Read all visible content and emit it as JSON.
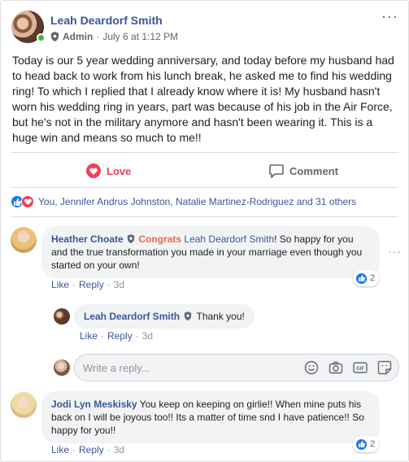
{
  "post": {
    "author": "Leah Deardorf Smith",
    "role": "Admin",
    "date_sep": "·",
    "date": "July 6 at 1:12 PM",
    "more": "···",
    "text": "Today is our 5 year wedding anniversary, and today before my husband had to head back to work from his lunch break, he asked me to find his wedding ring! To which I replied that I already know where it is! My husband hasn't worn his wedding ring in years, part was because of his job in the Air Force, but he's not in the military anymore and hasn't been wearing it. This is a huge win and means so much to me!!"
  },
  "actions": {
    "love": "Love",
    "comment": "Comment"
  },
  "reactions": {
    "summary": "You, Jennifer Andrus Johnston, Natalie Martinez-Rodriguez and 31 others"
  },
  "comments": [
    {
      "author": "Heather Choate",
      "accent": "Congrats",
      "mention": "Leah Deardorf Smith",
      "text": "! So happy for you and the true transformation you made in your marriage even though you started on your own!",
      "like": "Like",
      "sep": "·",
      "reply": "Reply",
      "time": "3d",
      "reactions": "2",
      "reply_item": {
        "author": "Leah Deardorf Smith",
        "text": "Thank you!",
        "like": "Like",
        "sep": "·",
        "reply": "Reply",
        "time": "3d"
      }
    },
    {
      "author": "Jodi Lyn Meskisky",
      "text": "You keep on keeping on girlie!! When mine puts his back on I will be joyous too!! Its a matter of time snd I have patience!! So happy for you!!",
      "like": "Like",
      "sep": "·",
      "reply": "Reply",
      "time": "3d",
      "reactions": "2"
    }
  ],
  "reply_box": {
    "placeholder": "Write a reply..."
  },
  "colors": {
    "link": "#385898",
    "love": "#f33e58",
    "like": "#1877f2",
    "online": "#42b72a",
    "accent": "#e56b4e"
  },
  "icons": [
    "shield-icon",
    "heart-icon",
    "comment-icon",
    "like-icon",
    "emoji-icon",
    "camera-icon",
    "gif-icon",
    "sticker-icon",
    "more-icon"
  ]
}
